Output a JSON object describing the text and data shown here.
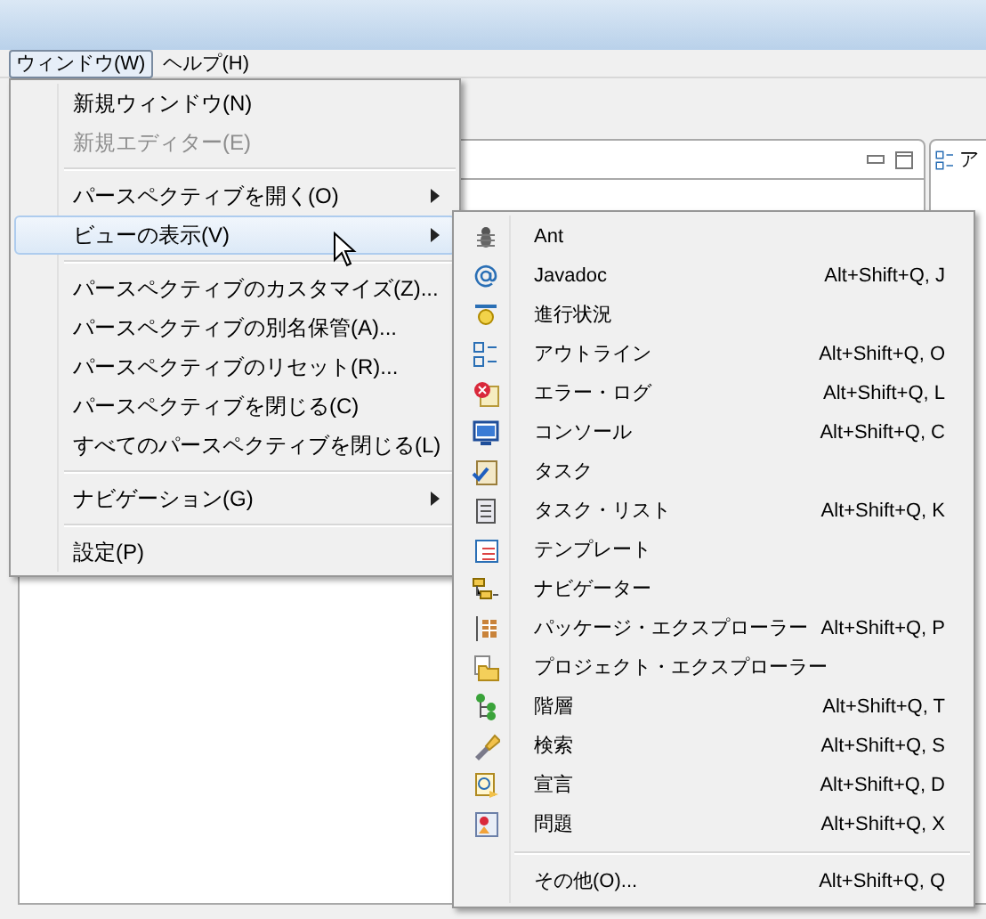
{
  "menubar": [
    {
      "label": "ウィンドウ(W)",
      "selected": true
    },
    {
      "label": "ヘルプ(H)",
      "selected": false
    }
  ],
  "panel_tab": {
    "label": "ア"
  },
  "menu": [
    {
      "kind": "item",
      "label": "新規ウィンドウ(N)",
      "disabled": false,
      "submenu": false,
      "selected": false
    },
    {
      "kind": "item",
      "label": "新規エディター(E)",
      "disabled": true,
      "submenu": false,
      "selected": false
    },
    {
      "kind": "separator"
    },
    {
      "kind": "item",
      "label": "パースペクティブを開く(O)",
      "disabled": false,
      "submenu": true,
      "selected": false
    },
    {
      "kind": "item",
      "label": "ビューの表示(V)",
      "disabled": false,
      "submenu": true,
      "selected": true
    },
    {
      "kind": "separator"
    },
    {
      "kind": "item",
      "label": "パースペクティブのカスタマイズ(Z)...",
      "disabled": false,
      "submenu": false,
      "selected": false
    },
    {
      "kind": "item",
      "label": "パースペクティブの別名保管(A)...",
      "disabled": false,
      "submenu": false,
      "selected": false
    },
    {
      "kind": "item",
      "label": "パースペクティブのリセット(R)...",
      "disabled": false,
      "submenu": false,
      "selected": false
    },
    {
      "kind": "item",
      "label": "パースペクティブを閉じる(C)",
      "disabled": false,
      "submenu": false,
      "selected": false
    },
    {
      "kind": "item",
      "label": "すべてのパースペクティブを閉じる(L)",
      "disabled": false,
      "submenu": false,
      "selected": false
    },
    {
      "kind": "separator"
    },
    {
      "kind": "item",
      "label": "ナビゲーション(G)",
      "disabled": false,
      "submenu": true,
      "selected": false
    },
    {
      "kind": "separator"
    },
    {
      "kind": "item",
      "label": "設定(P)",
      "disabled": false,
      "submenu": false,
      "selected": false
    }
  ],
  "submenu": [
    {
      "kind": "item",
      "label": "Ant"
    },
    {
      "kind": "item",
      "label": "Javadoc",
      "shortcut": "Alt+Shift+Q, J"
    },
    {
      "kind": "item",
      "label": "進行状況"
    },
    {
      "kind": "item",
      "label": "アウトライン",
      "shortcut": "Alt+Shift+Q, O"
    },
    {
      "kind": "item",
      "label": "エラー・ログ",
      "shortcut": "Alt+Shift+Q, L"
    },
    {
      "kind": "item",
      "label": "コンソール",
      "shortcut": "Alt+Shift+Q, C"
    },
    {
      "kind": "item",
      "label": "タスク"
    },
    {
      "kind": "item",
      "label": "タスク・リスト",
      "shortcut": "Alt+Shift+Q, K"
    },
    {
      "kind": "item",
      "label": "テンプレート"
    },
    {
      "kind": "item",
      "label": "ナビゲーター"
    },
    {
      "kind": "item",
      "label": "パッケージ・エクスプローラー",
      "shortcut": "Alt+Shift+Q, P"
    },
    {
      "kind": "item",
      "label": "プロジェクト・エクスプローラー"
    },
    {
      "kind": "item",
      "label": "階層",
      "shortcut": "Alt+Shift+Q, T"
    },
    {
      "kind": "item",
      "label": "検索",
      "shortcut": "Alt+Shift+Q, S"
    },
    {
      "kind": "item",
      "label": "宣言",
      "shortcut": "Alt+Shift+Q, D"
    },
    {
      "kind": "item",
      "label": "問題",
      "shortcut": "Alt+Shift+Q, X"
    },
    {
      "kind": "separator"
    },
    {
      "kind": "item",
      "label": "その他(O)...",
      "shortcut": "Alt+Shift+Q, Q"
    }
  ]
}
